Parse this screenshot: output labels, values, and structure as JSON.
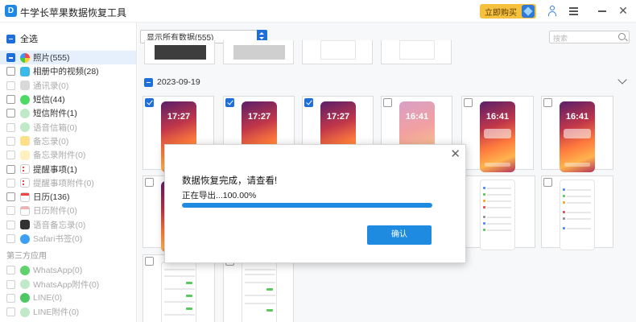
{
  "titlebar": {
    "title": "牛学长苹果数据恢复工具",
    "logo_letter": "D",
    "buy_label": "立即购买"
  },
  "sidebar": {
    "select_all_label": "全选",
    "items": [
      {
        "label": "照片(555)",
        "icon": "photos-icon",
        "state": "partial",
        "active": true,
        "disabled": false
      },
      {
        "label": "相册中的视频(28)",
        "icon": "video-icon",
        "state": "empty",
        "active": false,
        "disabled": false
      },
      {
        "label": "通讯录(0)",
        "icon": "contacts-icon",
        "state": "empty",
        "active": false,
        "disabled": true
      },
      {
        "label": "短信(44)",
        "icon": "messages-icon",
        "state": "empty",
        "active": false,
        "disabled": false
      },
      {
        "label": "短信附件(1)",
        "icon": "message-attachment-icon",
        "state": "empty",
        "active": false,
        "disabled": false
      },
      {
        "label": "语音信箱(0)",
        "icon": "voicemail-icon",
        "state": "empty",
        "active": false,
        "disabled": true
      },
      {
        "label": "备忘录(0)",
        "icon": "notes-icon",
        "state": "empty",
        "active": false,
        "disabled": true
      },
      {
        "label": "备忘录附件(0)",
        "icon": "notes-attachment-icon",
        "state": "empty",
        "active": false,
        "disabled": true
      },
      {
        "label": "提醒事项(1)",
        "icon": "reminders-icon",
        "state": "empty",
        "active": false,
        "disabled": false
      },
      {
        "label": "提醒事项附件(0)",
        "icon": "reminders-attachment-icon",
        "state": "empty",
        "active": false,
        "disabled": true
      },
      {
        "label": "日历(136)",
        "icon": "calendar-icon",
        "state": "empty",
        "active": false,
        "disabled": false
      },
      {
        "label": "日历附件(0)",
        "icon": "calendar-attachment-icon",
        "state": "empty",
        "active": false,
        "disabled": true
      },
      {
        "label": "语音备忘录(0)",
        "icon": "voice-memo-icon",
        "state": "empty",
        "active": false,
        "disabled": true
      },
      {
        "label": "Safari书签(0)",
        "icon": "safari-icon",
        "state": "empty",
        "active": false,
        "disabled": true
      }
    ],
    "section_third_party": "第三方应用",
    "third_party_items": [
      {
        "label": "WhatsApp(0)",
        "icon": "whatsapp-icon",
        "state": "empty",
        "disabled": true
      },
      {
        "label": "WhatsApp附件(0)",
        "icon": "whatsapp-attachment-icon",
        "state": "empty",
        "disabled": true
      },
      {
        "label": "LINE(0)",
        "icon": "line-icon",
        "state": "empty",
        "disabled": true
      },
      {
        "label": "LINE附件(0)",
        "icon": "line-attachment-icon",
        "state": "empty",
        "disabled": true
      }
    ]
  },
  "main": {
    "filter_value": "显示所有数据(555)",
    "search_placeholder": "搜索",
    "date_group": "2023-09-19",
    "thumbs": [
      {
        "time": "17:27",
        "checked": true,
        "kind": "lock"
      },
      {
        "time": "17:27",
        "checked": true,
        "kind": "lock"
      },
      {
        "time": "17:27",
        "checked": true,
        "kind": "lock"
      },
      {
        "time": "16:41",
        "checked": false,
        "kind": "lock"
      },
      {
        "time": "16:41",
        "checked": false,
        "kind": "lock-widgets"
      },
      {
        "time": "16:41",
        "checked": false,
        "kind": "lock-widgets"
      }
    ]
  },
  "dialog": {
    "title": "数据恢复完成，请查看!",
    "status": "正在导出...100.00%",
    "progress": 1.0,
    "ok_label": "确认"
  },
  "colors": {
    "accent": "#1e6fd9",
    "progress": "#1e8be0",
    "buy": "#f6c23e"
  }
}
